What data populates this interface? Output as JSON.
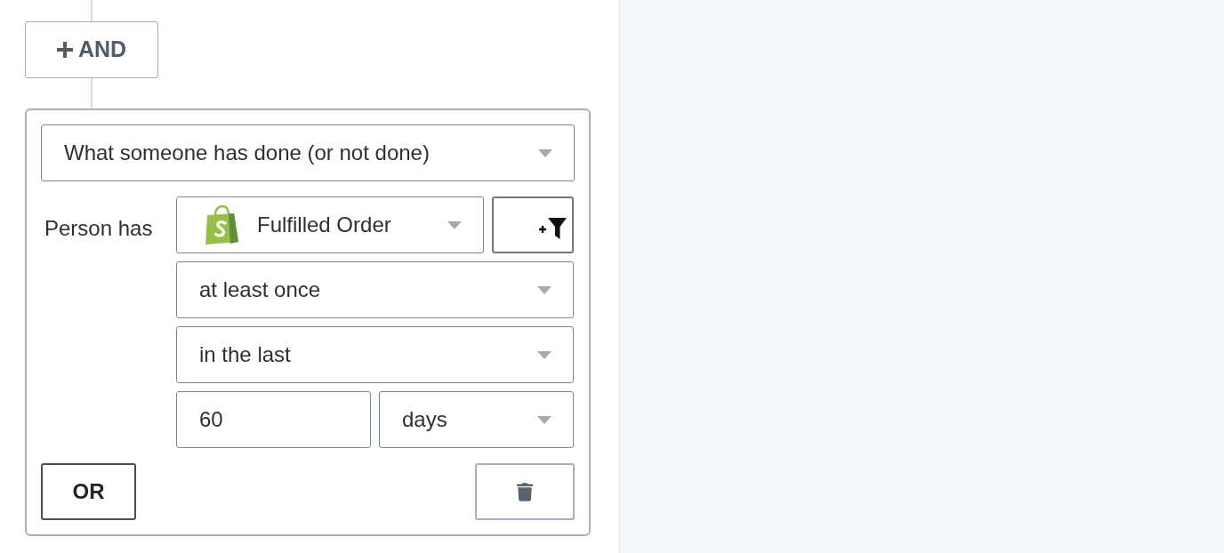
{
  "and_button": {
    "label": "AND"
  },
  "condition": {
    "type_select": {
      "value": "What someone has done (or not done)"
    },
    "label": "Person has",
    "event_select": {
      "value": "Fulfilled Order"
    },
    "frequency_select": {
      "value": "at least once"
    },
    "timeframe_select": {
      "value": "in the last"
    },
    "count_field": {
      "value": "60"
    },
    "unit_select": {
      "value": "days"
    },
    "or_button": {
      "label": "OR"
    }
  }
}
